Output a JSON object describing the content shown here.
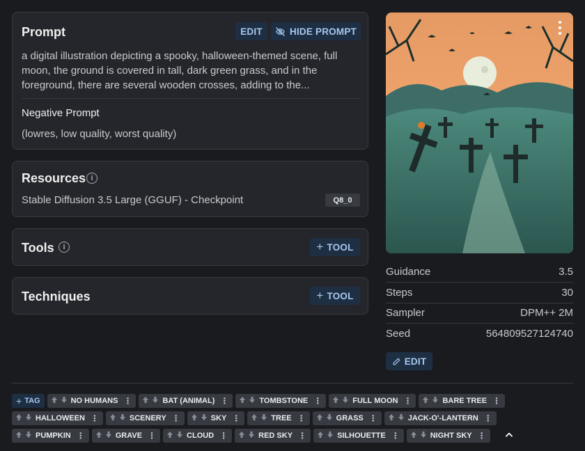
{
  "prompt_card": {
    "title": "Prompt",
    "edit_label": "EDIT",
    "hide_label": "HIDE PROMPT",
    "text": "a digital illustration depicting a spooky, halloween-themed scene, full moon, the ground is covered in tall, dark green grass, and in the foreground, there are several wooden crosses, adding to the...",
    "negative_title": "Negative Prompt",
    "negative_text": "(lowres, low quality, worst quality)"
  },
  "resources_card": {
    "title": "Resources",
    "resource_name": "Stable Diffusion 3.5 Large (GGUF) - Checkpoint",
    "resource_badge": "Q8_0"
  },
  "tools_card": {
    "title": "Tools",
    "add_label": "TOOL"
  },
  "techniques_card": {
    "title": "Techniques",
    "add_label": "TOOL"
  },
  "image": {
    "menu_icon": "kebab-menu-icon"
  },
  "stats": [
    {
      "label": "Guidance",
      "value": "3.5"
    },
    {
      "label": "Steps",
      "value": "30"
    },
    {
      "label": "Sampler",
      "value": "DPM++ 2M"
    },
    {
      "label": "Seed",
      "value": "564809527124740"
    }
  ],
  "edit_button": {
    "label": "EDIT"
  },
  "tags": {
    "add_label": "TAG",
    "items": [
      "NO HUMANS",
      "BAT (ANIMAL)",
      "TOMBSTONE",
      "FULL MOON",
      "BARE TREE",
      "HALLOWEEN",
      "SCENERY",
      "SKY",
      "TREE",
      "GRASS",
      "JACK-O'-LANTERN",
      "PUMPKIN",
      "GRAVE",
      "CLOUD",
      "RED SKY",
      "SILHOUETTE",
      "NIGHT SKY"
    ]
  },
  "colors": {
    "background": "#1a1b1e",
    "card": "#25262b",
    "accent": "#a5c8f0",
    "button_bg": "#1f2f43"
  }
}
